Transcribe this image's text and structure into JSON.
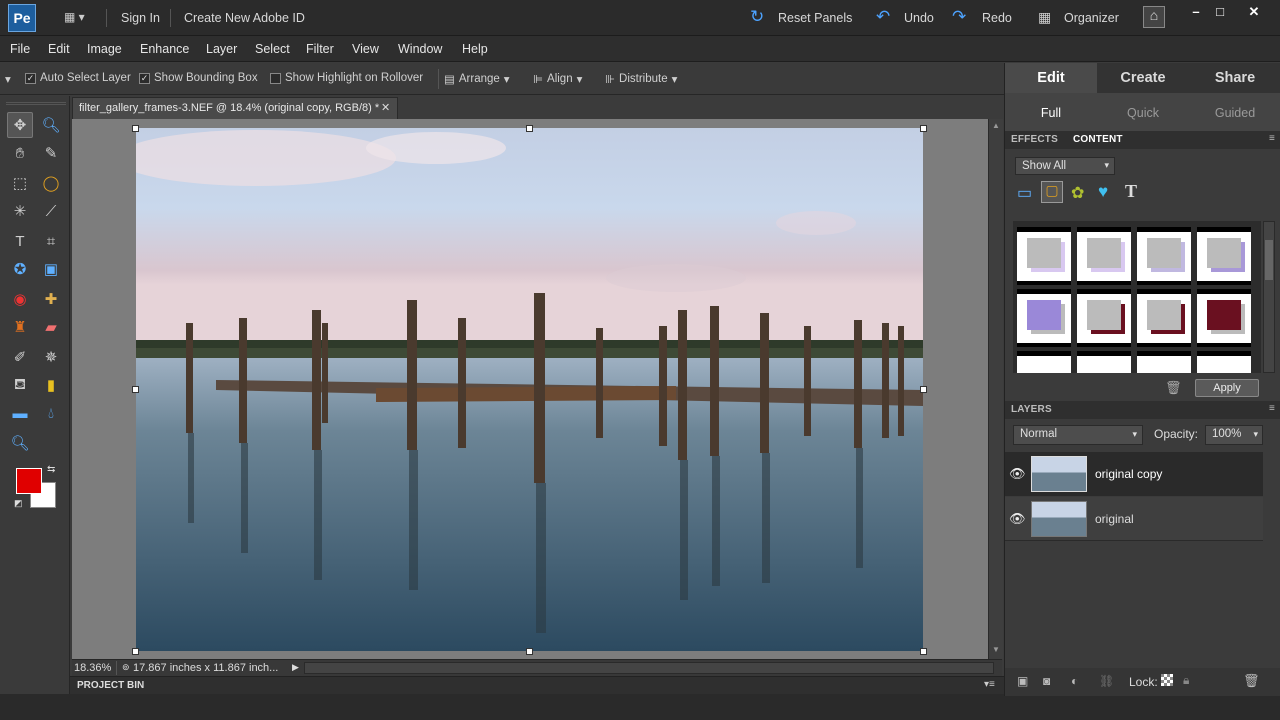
{
  "topbar": {
    "app_logo": "Pe",
    "sign_in": "Sign In",
    "create_id": "Create New Adobe ID",
    "reset_panels": "Reset Panels",
    "undo": "Undo",
    "redo": "Redo",
    "organizer": "Organizer"
  },
  "menu": [
    "File",
    "Edit",
    "Image",
    "Enhance",
    "Layer",
    "Select",
    "Filter",
    "View",
    "Window",
    "Help"
  ],
  "options": {
    "auto_select": "Auto Select Layer",
    "bounding_box": "Show Bounding Box",
    "highlight": "Show Highlight on Rollover",
    "arrange": "Arrange",
    "align": "Align",
    "distribute": "Distribute"
  },
  "document": {
    "tab_title": "filter_gallery_frames-3.NEF @ 18.4% (original copy, RGB/8) *",
    "zoom": "18.36%",
    "size_info": "17.867 inches x 11.867 inch..."
  },
  "project_bin": "PROJECT BIN",
  "right_panel": {
    "mode_tabs": [
      "Edit",
      "Create",
      "Share"
    ],
    "sub_tabs": [
      "Full",
      "Quick",
      "Guided"
    ],
    "panel_tabs": [
      "EFFECTS",
      "CONTENT"
    ],
    "show_filter": "Show All",
    "apply": "Apply",
    "layers_title": "LAYERS",
    "blend_mode": "Normal",
    "opacity_label": "Opacity:",
    "opacity_value": "100%",
    "layers": [
      {
        "name": "original copy"
      },
      {
        "name": "original"
      }
    ],
    "lock_label": "Lock:"
  },
  "colors": {
    "foreground": "#e00000",
    "background": "#ffffff",
    "accent": "#4da3ff"
  }
}
